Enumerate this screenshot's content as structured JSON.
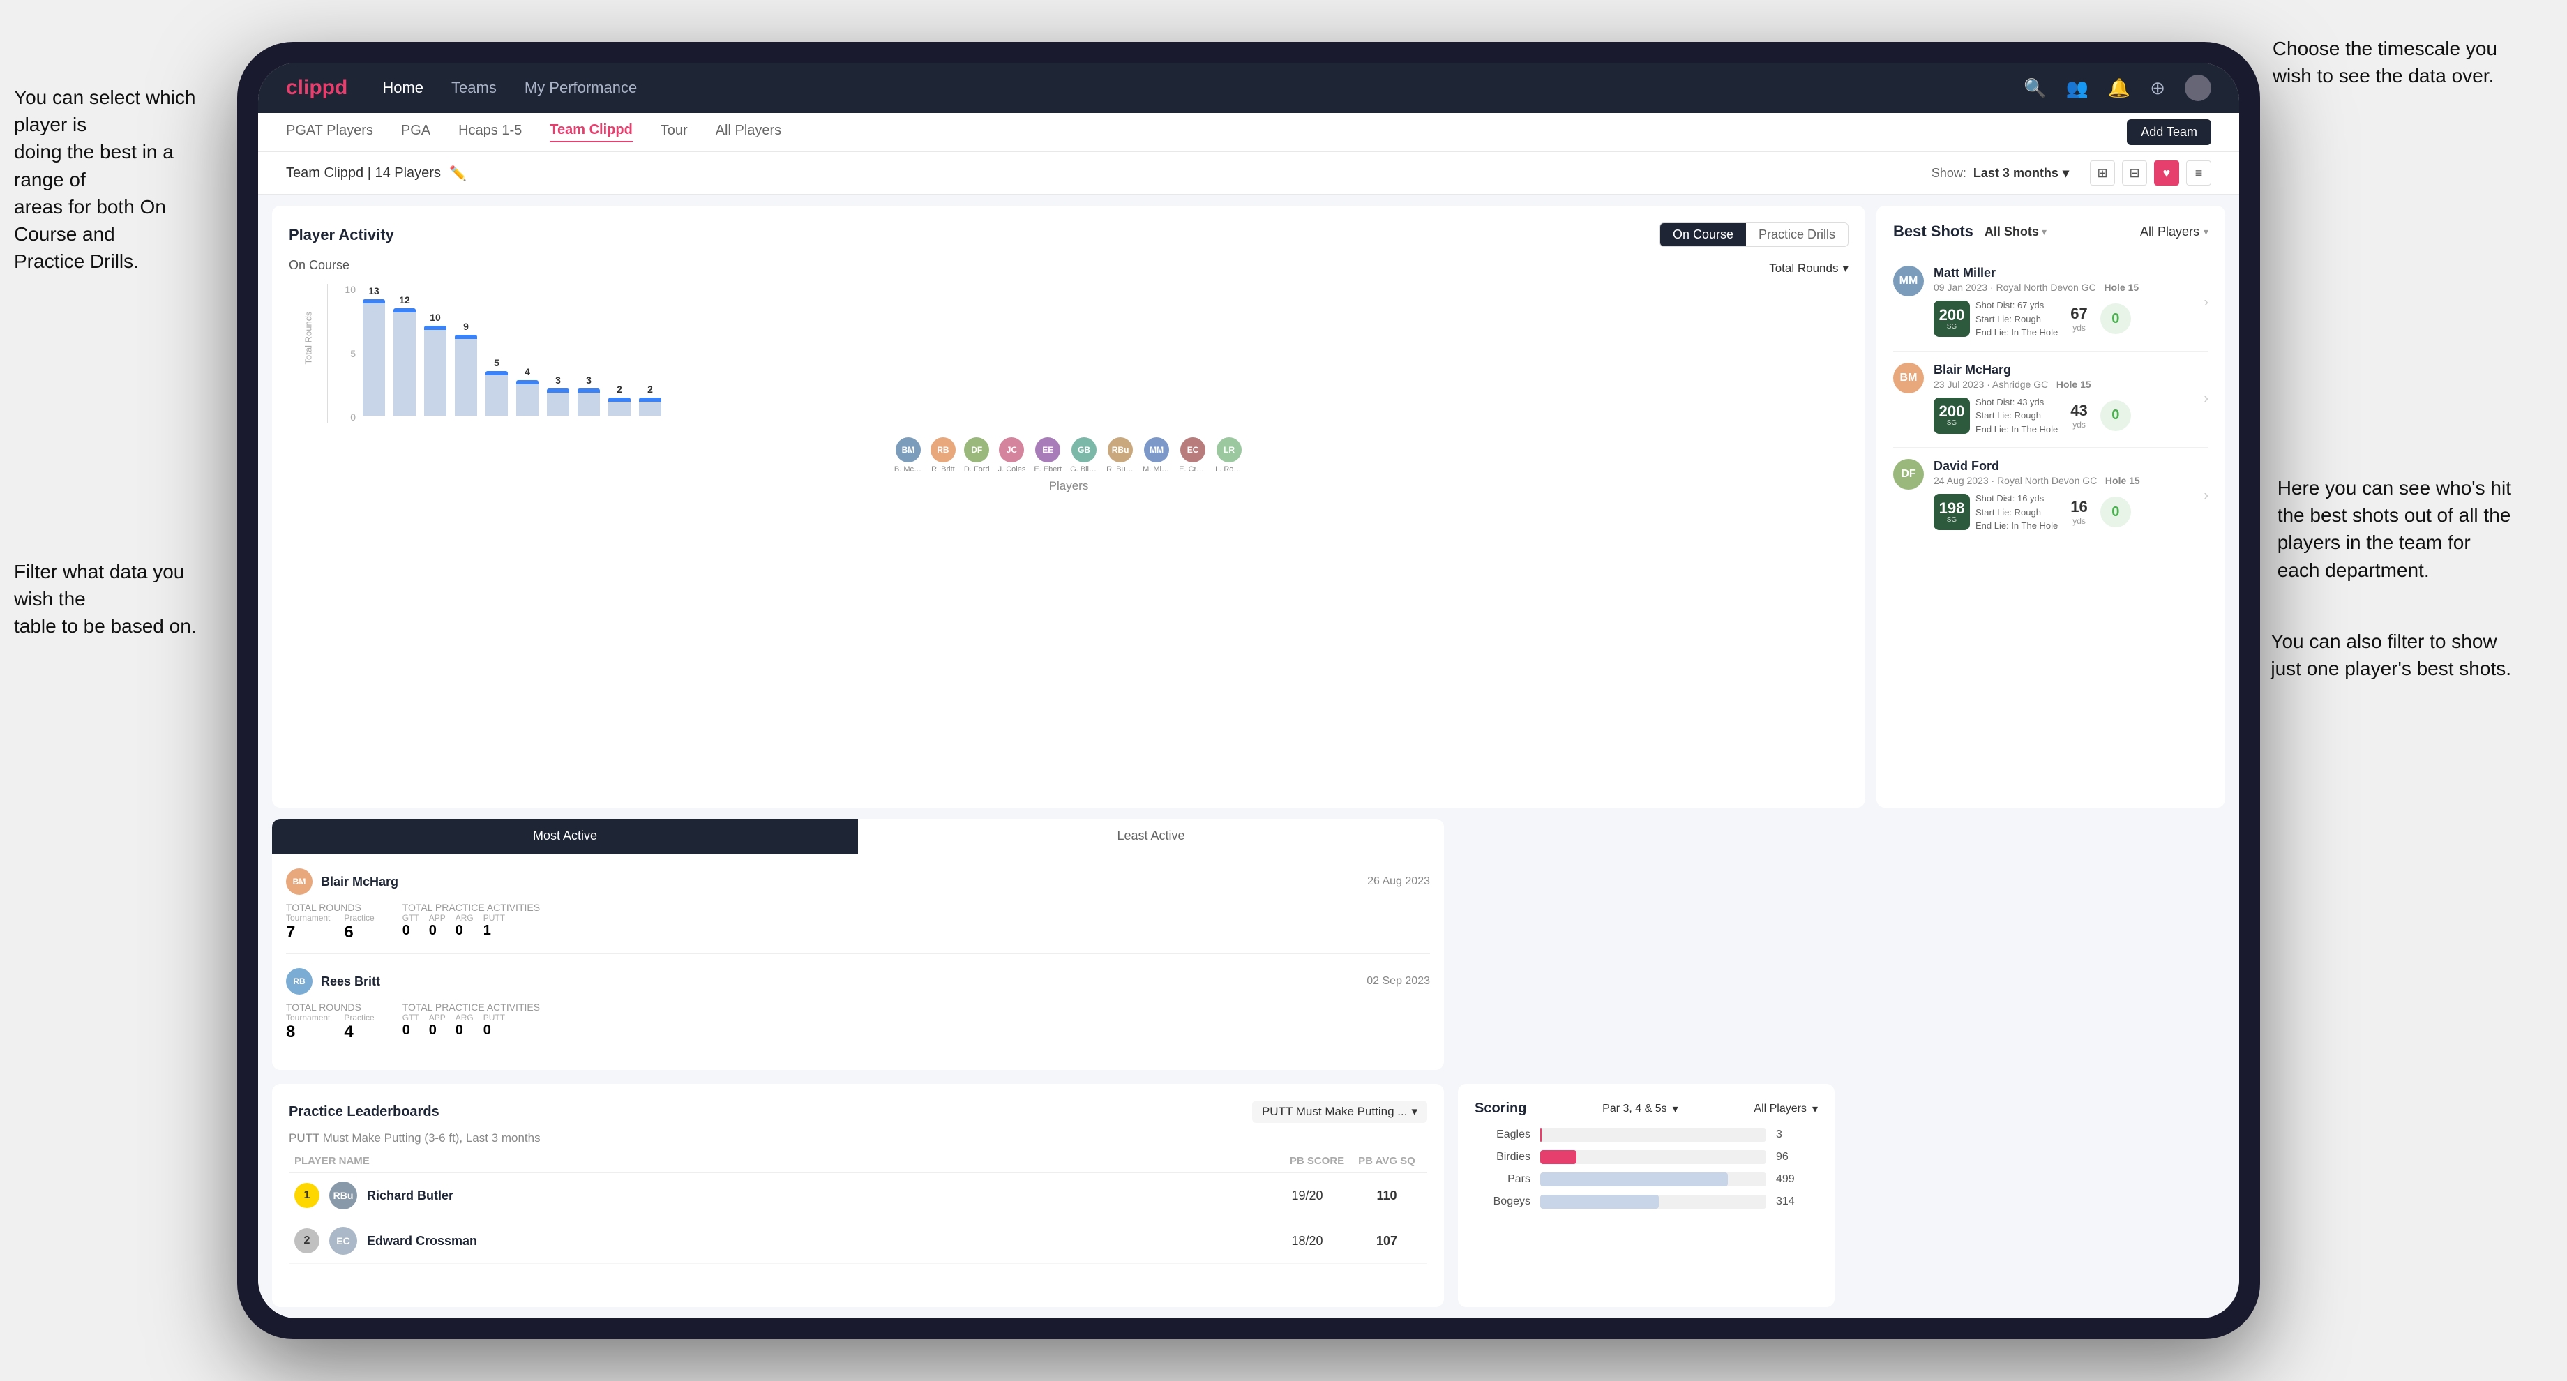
{
  "annotations": {
    "top_right": "Choose the timescale you\nwish to see the data over.",
    "left_top": "You can select which player is\ndoing the best in a range of\nareas for both On Course and\nPractice Drills.",
    "left_bottom": "Filter what data you wish the\ntable to be based on.",
    "right_mid": "Here you can see who's hit\nthe best shots out of all the\nplayers in the team for\neach department.",
    "right_bottom": "You can also filter to show\njust one player's best shots."
  },
  "nav": {
    "logo": "clippd",
    "links": [
      "Home",
      "Teams",
      "My Performance"
    ],
    "icons": [
      "search",
      "people",
      "bell",
      "add-circle",
      "avatar"
    ]
  },
  "sub_nav": {
    "items": [
      "PGAT Players",
      "PGA",
      "Hcaps 1-5",
      "Team Clippd",
      "Tour",
      "All Players"
    ],
    "active": "Team Clippd",
    "add_button": "Add Team"
  },
  "team_header": {
    "name": "Team Clippd | 14 Players",
    "show_label": "Show:",
    "show_value": "Last 3 months",
    "views": [
      "grid4",
      "grid2",
      "heart",
      "list"
    ]
  },
  "player_activity": {
    "title": "Player Activity",
    "tabs": [
      "On Course",
      "Practice Drills"
    ],
    "active_tab": "On Course",
    "section": "On Course",
    "chart_filter": "Total Rounds",
    "y_labels": [
      "0",
      "5",
      "10"
    ],
    "players": [
      {
        "name": "B. McHarg",
        "value": 13,
        "initials": "BM"
      },
      {
        "name": "R. Britt",
        "value": 12,
        "initials": "RB"
      },
      {
        "name": "D. Ford",
        "value": 10,
        "initials": "DF"
      },
      {
        "name": "J. Coles",
        "value": 9,
        "initials": "JC"
      },
      {
        "name": "E. Ebert",
        "value": 5,
        "initials": "EE"
      },
      {
        "name": "G. Billingham",
        "value": 4,
        "initials": "GB"
      },
      {
        "name": "R. Butler",
        "value": 3,
        "initials": "RBu"
      },
      {
        "name": "M. Miller",
        "value": 3,
        "initials": "MM"
      },
      {
        "name": "E. Crossman",
        "value": 2,
        "initials": "EC"
      },
      {
        "name": "L. Robertson",
        "value": 2,
        "initials": "LR"
      }
    ],
    "x_label": "Players",
    "y_label": "Total Rounds"
  },
  "best_shots": {
    "title": "Best Shots",
    "filter1": "All Shots",
    "filter2": "All Players",
    "entries": [
      {
        "name": "Matt Miller",
        "date": "09 Jan 2023 · Royal North Devon GC",
        "hole": "Hole 15",
        "badge_num": "200",
        "badge_label": "SG",
        "dist": "Shot Dist: 67 yds\nStart Lie: Rough\nEnd Lie: In The Hole",
        "stat1_value": "67",
        "stat1_unit": "yds",
        "stat2_value": "0",
        "initials": "MM",
        "avatar_color": "#7b9cba"
      },
      {
        "name": "Blair McHarg",
        "date": "23 Jul 2023 · Ashridge GC",
        "hole": "Hole 15",
        "badge_num": "200",
        "badge_label": "SG",
        "dist": "Shot Dist: 43 yds\nStart Lie: Rough\nEnd Lie: In The Hole",
        "stat1_value": "43",
        "stat1_unit": "yds",
        "stat2_value": "0",
        "initials": "BM",
        "avatar_color": "#e8a87c"
      },
      {
        "name": "David Ford",
        "date": "24 Aug 2023 · Royal North Devon GC",
        "hole": "Hole 15",
        "badge_num": "198",
        "badge_label": "SG",
        "dist": "Shot Dist: 16 yds\nStart Lie: Rough\nEnd Lie: In The Hole",
        "stat1_value": "16",
        "stat1_unit": "yds",
        "stat2_value": "0",
        "initials": "DF",
        "avatar_color": "#9ab87c"
      }
    ]
  },
  "practice_leaderboards": {
    "title": "Practice Leaderboards",
    "drill": "PUTT Must Make Putting ...",
    "subtitle": "PUTT Must Make Putting (3-6 ft), Last 3 months",
    "cols": [
      "PLAYER NAME",
      "PB SCORE",
      "PB AVG SQ"
    ],
    "rows": [
      {
        "rank": 1,
        "name": "Richard Butler",
        "sub": "",
        "score": "19/20",
        "avg": "110",
        "initials": "RBu",
        "color": "#8899aa"
      },
      {
        "rank": 2,
        "name": "Edward Crossman",
        "sub": "",
        "score": "18/20",
        "avg": "107",
        "initials": "EC",
        "color": "#aab8c8"
      }
    ]
  },
  "most_active": {
    "tabs": [
      "Most Active",
      "Least Active"
    ],
    "active_tab": "Most Active",
    "players": [
      {
        "name": "Blair McHarg",
        "date": "26 Aug 2023",
        "total_rounds_label": "Total Rounds",
        "tournament": "7",
        "practice": "6",
        "practice_activities_label": "Total Practice Activities",
        "gtt": "0",
        "app": "0",
        "arg": "0",
        "putt": "1",
        "initials": "BM",
        "color": "#e8a87c"
      },
      {
        "name": "Rees Britt",
        "date": "02 Sep 2023",
        "total_rounds_label": "Total Rounds",
        "tournament": "8",
        "practice": "4",
        "practice_activities_label": "Total Practice Activities",
        "gtt": "0",
        "app": "0",
        "arg": "0",
        "putt": "0",
        "initials": "RB",
        "color": "#7bacd4"
      }
    ]
  },
  "scoring": {
    "title": "Scoring",
    "filter1": "Par 3, 4 & 5s",
    "filter2": "All Players",
    "bars": [
      {
        "label": "Eagles",
        "value": 3,
        "max": 600,
        "color": "#e63e6d"
      },
      {
        "label": "Birdies",
        "value": 96,
        "max": 600,
        "color": "#e63e6d"
      },
      {
        "label": "Pars",
        "value": 499,
        "max": 600,
        "color": "#c8d4e8"
      },
      {
        "label": "Bogeys",
        "value": 314,
        "max": 600,
        "color": "#c8d4e8"
      }
    ]
  }
}
